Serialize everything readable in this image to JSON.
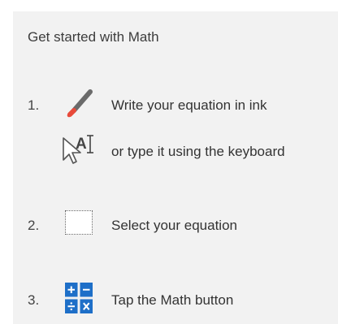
{
  "panel": {
    "title": "Get started with Math",
    "steps": [
      {
        "number": "1.",
        "lines": [
          {
            "icon": "ink-pen-icon",
            "text": "Write your equation in ink"
          },
          {
            "icon": "keyboard-text-cursor-icon",
            "text": "or type it using the keyboard",
            "icon_letter": "A"
          }
        ]
      },
      {
        "number": "2.",
        "lines": [
          {
            "icon": "selection-box-icon",
            "text": "Select your equation"
          }
        ]
      },
      {
        "number": "3.",
        "lines": [
          {
            "icon": "math-button-icon",
            "text": "Tap the Math button"
          }
        ]
      }
    ]
  },
  "colors": {
    "panel_background": "#f2f2f2",
    "pen_accent": "#e84a3a",
    "math_icon_blue": "#1e6fc8"
  }
}
